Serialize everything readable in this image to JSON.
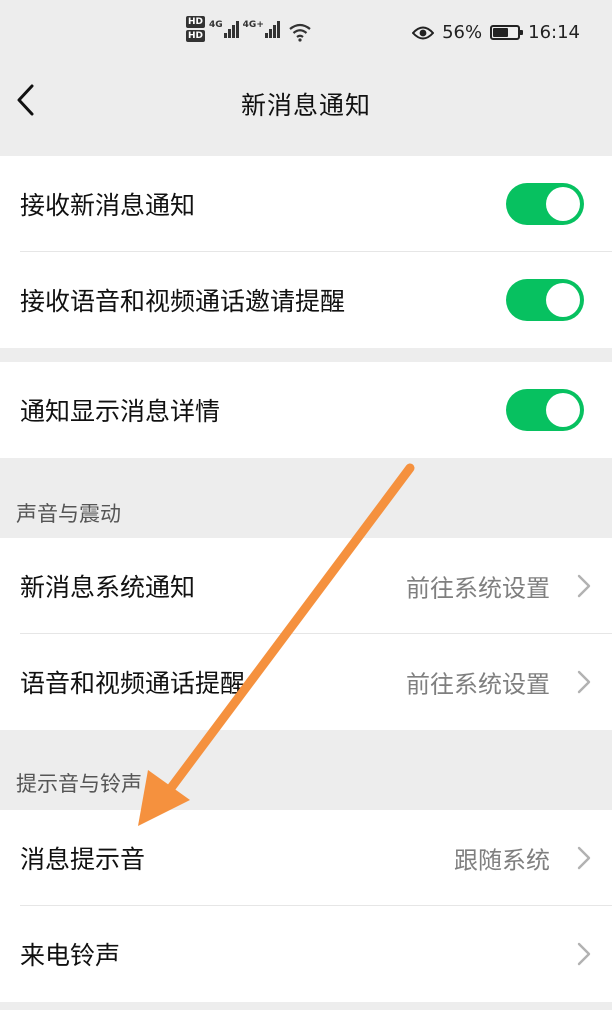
{
  "status_bar": {
    "hd_badges": [
      "HD",
      "HD"
    ],
    "network_labels": [
      "4G",
      "4G+"
    ],
    "battery_percent": "56%",
    "battery_level": 0.56,
    "time": "16:14",
    "icons": [
      "eye-icon",
      "wifi-icon",
      "battery-icon",
      "signal-icon"
    ]
  },
  "nav": {
    "back_icon": "chevron-left-icon",
    "title": "新消息通知"
  },
  "groups": {
    "notifications": [
      {
        "label": "接收新消息通知",
        "toggle": "on"
      },
      {
        "label": "接收语音和视频通话邀请提醒",
        "toggle": "on"
      }
    ],
    "details": [
      {
        "label": "通知显示消息详情",
        "toggle": "on"
      }
    ],
    "sound_title": "声音与震动",
    "sound": [
      {
        "label": "新消息系统通知",
        "value": "前往系统设置"
      },
      {
        "label": "语音和视频通话提醒",
        "value": "前往系统设置"
      }
    ],
    "ringtone_title": "提示音与铃声",
    "ringtone": [
      {
        "label": "消息提示音",
        "value": "跟随系统"
      },
      {
        "label": "来电铃声",
        "value": ""
      }
    ]
  },
  "colors": {
    "toggle_on": "#07c160",
    "annotation_arrow": "#f5913e",
    "background": "#ededed"
  }
}
